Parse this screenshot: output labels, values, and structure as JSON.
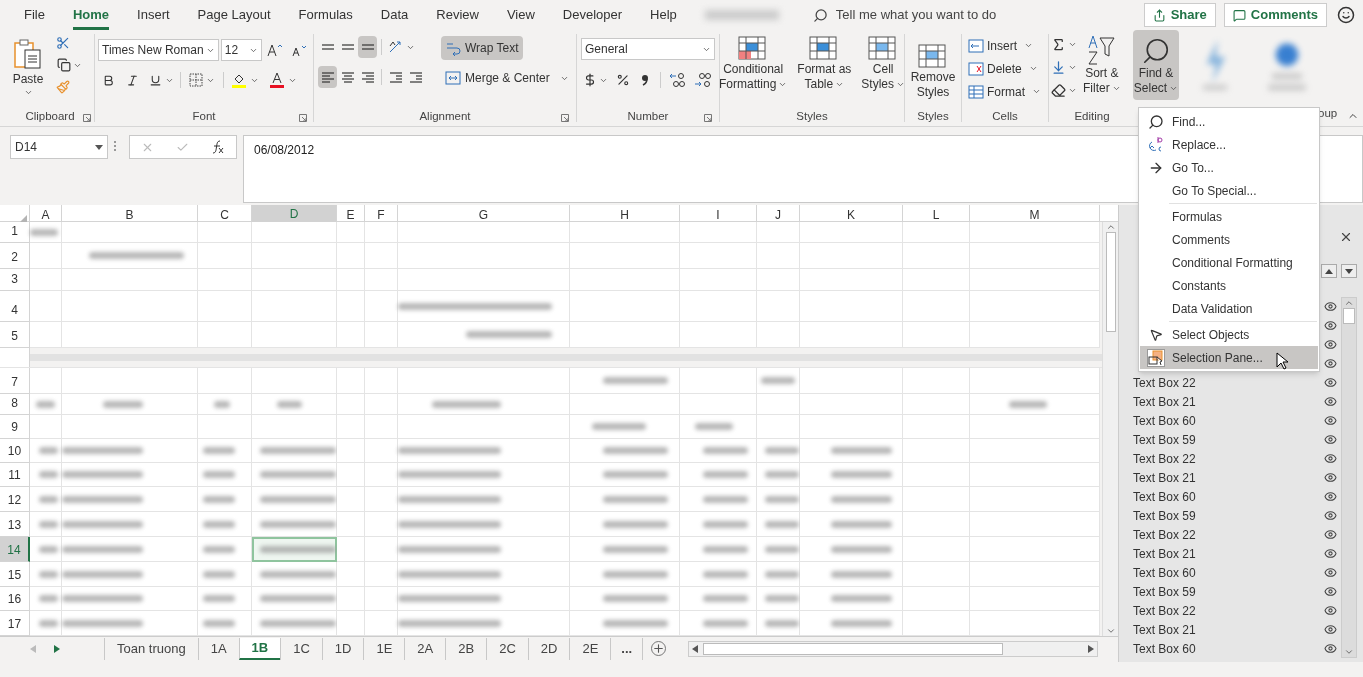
{
  "menu_tabs": [
    {
      "label": "File",
      "selected": false
    },
    {
      "label": "Home",
      "selected": true
    },
    {
      "label": "Insert",
      "selected": false
    },
    {
      "label": "Page Layout",
      "selected": false
    },
    {
      "label": "Formulas",
      "selected": false
    },
    {
      "label": "Data",
      "selected": false
    },
    {
      "label": "Review",
      "selected": false
    },
    {
      "label": "View",
      "selected": false
    },
    {
      "label": "Developer",
      "selected": false
    },
    {
      "label": "Help",
      "selected": false
    }
  ],
  "tell_me": {
    "placeholder": "Tell me what you want to do"
  },
  "share": "Share",
  "comments": "Comments",
  "ribbon": {
    "clipboard": {
      "label": "Clipboard",
      "paste": "Paste"
    },
    "font": {
      "label": "Font",
      "family": "Times New Roman",
      "size": "12"
    },
    "alignment": {
      "label": "Alignment",
      "wrap_text": "Wrap Text",
      "wrap_on": true,
      "merge": "Merge & Center",
      "bottom_on": true,
      "left_on": true
    },
    "number": {
      "label": "Number",
      "format": "General"
    },
    "styles": {
      "label": "Styles",
      "buttons": [
        {
          "lines": [
            "Conditional",
            "Formatting"
          ],
          "kind": "conditional"
        },
        {
          "lines": [
            "Format as",
            "Table"
          ],
          "kind": "table"
        },
        {
          "lines": [
            "Cell",
            "Styles"
          ],
          "kind": "cell"
        }
      ]
    },
    "styles2": {
      "label": "Styles",
      "button": [
        "Remove",
        "Styles"
      ]
    },
    "cells": {
      "label": "Cells",
      "buttons": [
        {
          "label": "Insert",
          "kind": "insert"
        },
        {
          "label": "Delete",
          "kind": "delete"
        },
        {
          "label": "Format",
          "kind": "format"
        }
      ]
    },
    "editing": {
      "label": "Editing",
      "sort": [
        "Sort &",
        "Filter"
      ],
      "find": [
        "Find &",
        "Select"
      ],
      "find_expanded": true
    },
    "cut_label": "oup"
  },
  "formula_bar": {
    "name_box": "D14",
    "value": "06/08/2012"
  },
  "columns": [
    {
      "label": "A",
      "selected": false
    },
    {
      "label": "B",
      "selected": false
    },
    {
      "label": "C",
      "selected": false
    },
    {
      "label": "D",
      "selected": true
    },
    {
      "label": "E",
      "selected": false
    },
    {
      "label": "F",
      "selected": false
    },
    {
      "label": "G",
      "selected": false
    },
    {
      "label": "H",
      "selected": false
    },
    {
      "label": "I",
      "selected": false
    },
    {
      "label": "J",
      "selected": false
    },
    {
      "label": "K",
      "selected": false
    },
    {
      "label": "L",
      "selected": false
    },
    {
      "label": "M",
      "selected": false
    }
  ],
  "rows": [
    {
      "label": "1",
      "selected": false
    },
    {
      "label": "2",
      "selected": false
    },
    {
      "label": "3",
      "selected": false
    },
    {
      "label": "4",
      "selected": false
    },
    {
      "label": "5",
      "selected": false
    },
    {
      "label": "7",
      "selected": false
    },
    {
      "label": "8",
      "selected": false
    },
    {
      "label": "9",
      "selected": false
    },
    {
      "label": "10",
      "selected": false
    },
    {
      "label": "11",
      "selected": false
    },
    {
      "label": "12",
      "selected": false
    },
    {
      "label": "13",
      "selected": false
    },
    {
      "label": "14",
      "selected": true
    },
    {
      "label": "15",
      "selected": false
    },
    {
      "label": "16",
      "selected": false
    },
    {
      "label": "17",
      "selected": false
    }
  ],
  "sheet_tabs": [
    {
      "label": "Toan truong",
      "selected": false
    },
    {
      "label": "1A",
      "selected": false
    },
    {
      "label": "1B",
      "selected": true
    },
    {
      "label": "1C",
      "selected": false
    },
    {
      "label": "1D",
      "selected": false
    },
    {
      "label": "1E",
      "selected": false
    },
    {
      "label": "2A",
      "selected": false
    },
    {
      "label": "2B",
      "selected": false
    },
    {
      "label": "2C",
      "selected": false
    },
    {
      "label": "2D",
      "selected": false
    },
    {
      "label": "2E",
      "selected": false
    }
  ],
  "more_tabs": "...",
  "find_menu": {
    "items": [
      {
        "label": "Find...",
        "kind": "find",
        "divider_before": false,
        "selected": false
      },
      {
        "label": "Replace...",
        "kind": "replace",
        "divider_before": false,
        "selected": false
      },
      {
        "label": "Go To...",
        "kind": "goto",
        "divider_before": false,
        "selected": false
      },
      {
        "label": "Go To Special...",
        "kind": "plain",
        "divider_before": false,
        "selected": false
      },
      {
        "label": "Formulas",
        "kind": "plain",
        "divider_before": true,
        "selected": false
      },
      {
        "label": "Comments",
        "kind": "plain",
        "divider_before": false,
        "selected": false
      },
      {
        "label": "Conditional Formatting",
        "kind": "plain",
        "divider_before": false,
        "selected": false
      },
      {
        "label": "Constants",
        "kind": "plain",
        "divider_before": false,
        "selected": false
      },
      {
        "label": "Data Validation",
        "kind": "plain",
        "divider_before": false,
        "selected": false
      },
      {
        "label": "Select Objects",
        "kind": "select",
        "divider_before": true,
        "selected": false
      },
      {
        "label": "Selection Pane...",
        "kind": "pane",
        "divider_before": false,
        "selected": true
      }
    ]
  },
  "selection_pane": {
    "items": [
      {
        "name": "Text Box 22",
        "visible": true
      },
      {
        "name": "Text Box 21",
        "visible": true
      },
      {
        "name": "Text Box 60",
        "visible": true
      },
      {
        "name": "Text Box 59",
        "visible": true
      },
      {
        "name": "Text Box 22",
        "visible": true
      },
      {
        "name": "Text Box 21",
        "visible": true
      },
      {
        "name": "Text Box 60",
        "visible": true
      },
      {
        "name": "Text Box 59",
        "visible": true
      },
      {
        "name": "Text Box 22",
        "visible": true
      },
      {
        "name": "Text Box 21",
        "visible": true
      },
      {
        "name": "Text Box 60",
        "visible": true
      },
      {
        "name": "Text Box 59",
        "visible": true
      },
      {
        "name": "Text Box 22",
        "visible": true
      },
      {
        "name": "Text Box 21",
        "visible": true
      },
      {
        "name": "Text Box 60",
        "visible": true
      }
    ]
  }
}
